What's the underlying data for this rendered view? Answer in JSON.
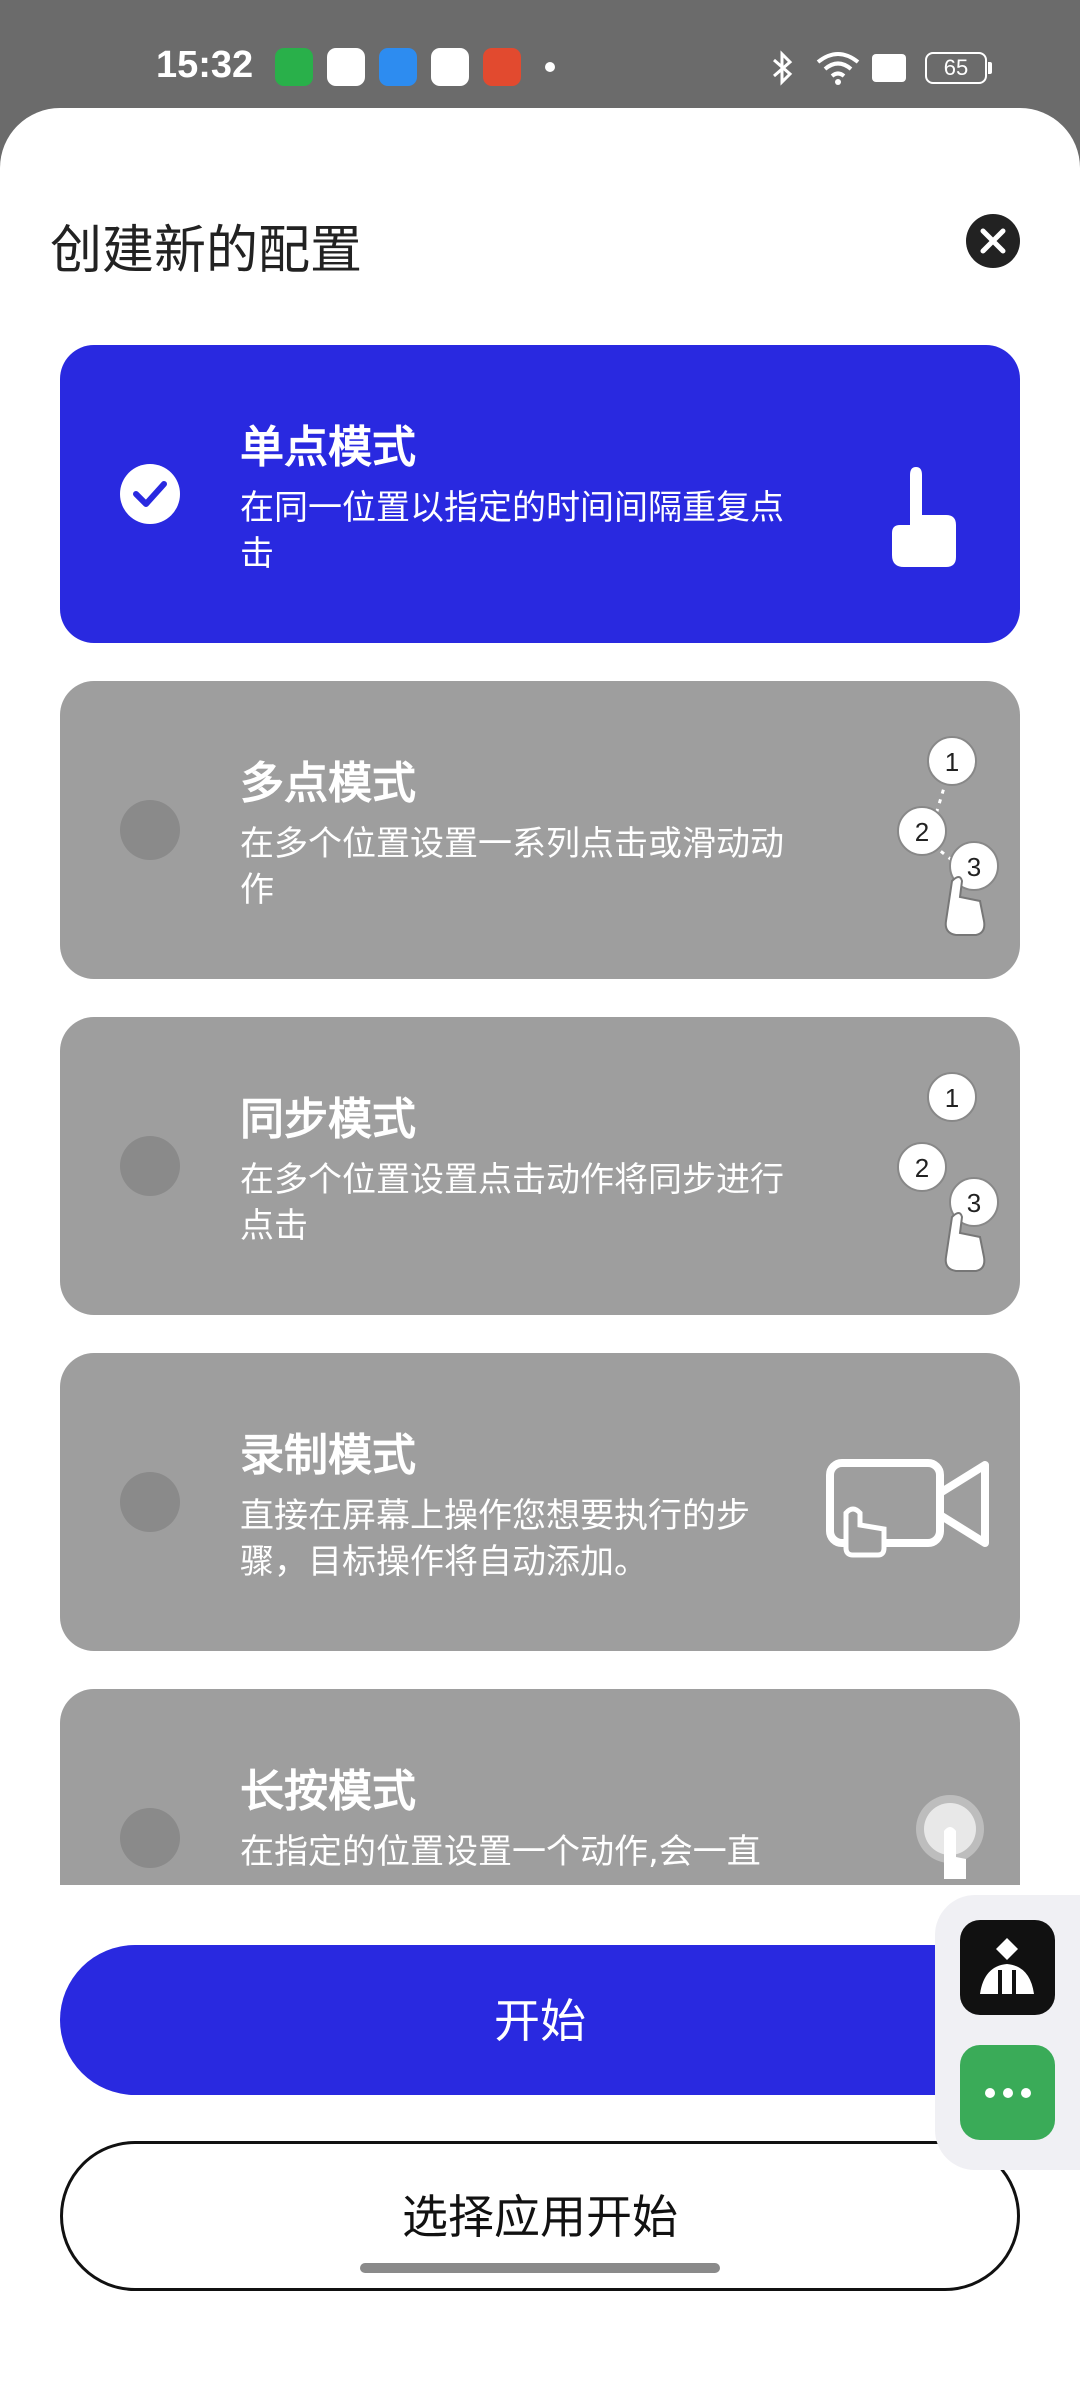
{
  "status_bar": {
    "time": "15:32",
    "battery": "65",
    "icons": [
      "shield-app-icon",
      "flower-app-icon",
      "cloud-drive-icon",
      "cloud-service-icon",
      "game-app-icon",
      "bluetooth-icon",
      "wifi-icon",
      "sim-icon",
      "battery-icon"
    ]
  },
  "sheet": {
    "title": "创建新的配置",
    "close_icon": "close-icon"
  },
  "modes": [
    {
      "title": "单点模式",
      "desc": "在同一位置以指定的时间间隔重复点击",
      "selected": true
    },
    {
      "title": "多点模式",
      "desc": "在多个位置设置一系列点击或滑动动作",
      "selected": false
    },
    {
      "title": "同步模式",
      "desc": "在多个位置设置点击动作将同步进行点击",
      "selected": false
    },
    {
      "title": "录制模式",
      "desc": "直接在屏幕上操作您想要执行的步骤，目标操作将自动添加。",
      "selected": false
    },
    {
      "title": "长按模式",
      "desc": "在指定的位置设置一个动作,会一直",
      "selected": false
    }
  ],
  "illustration_labels": [
    "1",
    "2",
    "3"
  ],
  "buttons": {
    "start": "开始",
    "choose_app": "选择应用开始"
  },
  "colors": {
    "accent": "#2929e0",
    "card_gray": "#9e9e9e",
    "chat_green": "#3aab58"
  }
}
